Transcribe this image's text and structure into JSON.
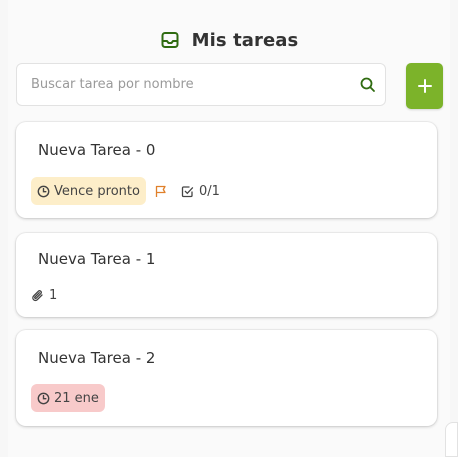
{
  "header": {
    "title": "Mis tareas",
    "icon": "inbox-icon"
  },
  "search": {
    "placeholder": "Buscar tarea por nombre",
    "value": "",
    "icon": "search-icon"
  },
  "add_button": {
    "label": "+"
  },
  "colors": {
    "accent": "#7cb32a",
    "warn_bg": "#fdeec9",
    "danger_bg": "#f8caca",
    "flag": "#e0802a"
  },
  "tasks": [
    {
      "title": "Nueva Tarea - 0",
      "due_label": "Vence pronto",
      "checklist": "0/1"
    },
    {
      "title": "Nueva Tarea - 1",
      "attachments": "1"
    },
    {
      "title": "Nueva Tarea - 2",
      "due_label": "21 ene"
    }
  ]
}
